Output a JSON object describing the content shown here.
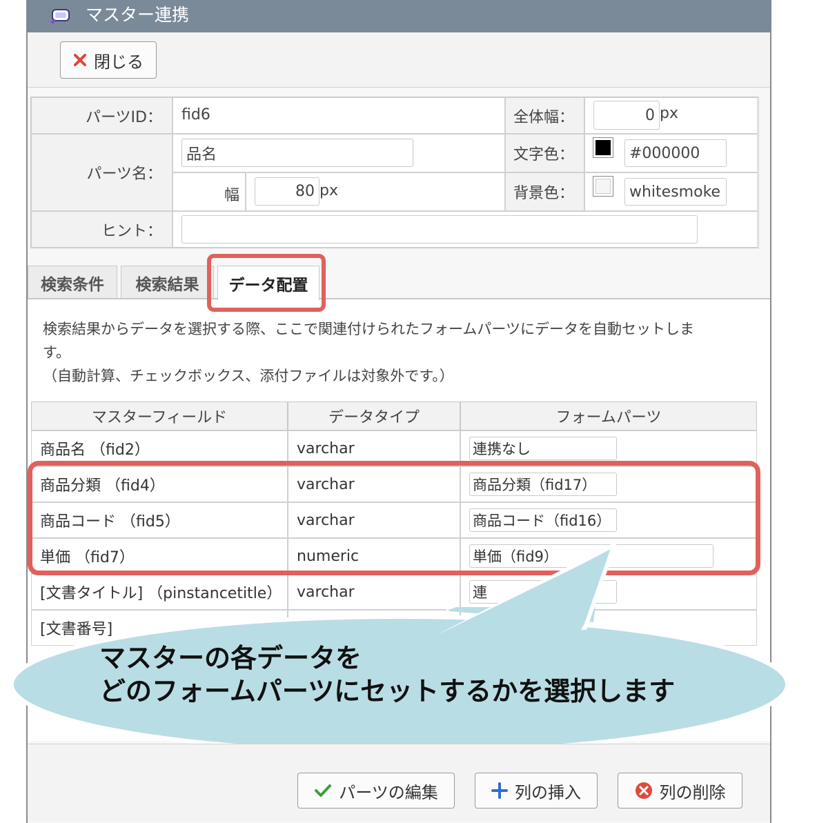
{
  "dialog": {
    "title": "マスター連携"
  },
  "toolbar": {
    "close_label": "閉じる"
  },
  "form": {
    "parts_id_label": "パーツID：",
    "parts_id_value": "fid6",
    "total_width_label": "全体幅：",
    "total_width_value": "0",
    "total_width_unit": "px",
    "parts_name_label": "パーツ名：",
    "parts_name_value": "品名",
    "text_color_label": "文字色：",
    "text_color_value": "#000000",
    "width_label": "幅",
    "width_value": "80",
    "width_unit": "px",
    "bg_color_label": "背景色：",
    "bg_color_value": "whitesmoke",
    "hint_label": "ヒント：",
    "hint_value": ""
  },
  "tabs": [
    {
      "label": "検索条件",
      "active": false
    },
    {
      "label": "検索結果",
      "active": false
    },
    {
      "label": "データ配置",
      "active": true
    }
  ],
  "description": {
    "line1": "検索結果からデータを選択する際、ここで関連付けられたフォームパーツにデータを自動セットしま",
    "line2": "す。",
    "line3": "（自動計算、チェックボックス、添付ファイルは対象外です。）"
  },
  "table": {
    "headers": [
      "マスターフィールド",
      "データタイプ",
      "フォームパーツ"
    ],
    "rows": [
      {
        "field": "商品名 （fid2）",
        "type": "varchar",
        "part": "連携なし"
      },
      {
        "field": "商品分類 （fid4）",
        "type": "varchar",
        "part": "商品分類（fid17）"
      },
      {
        "field": "商品コード （fid5）",
        "type": "varchar",
        "part": "商品コード（fid16）"
      },
      {
        "field": "単価 （fid7）",
        "type": "numeric",
        "part": "単価（fid9）"
      },
      {
        "field": "[文書タイトル] （pinstancetitle）",
        "type": "varchar",
        "part": "連"
      },
      {
        "field": "[文書番号]",
        "type": "",
        "part": ""
      }
    ]
  },
  "callout": {
    "line1": "マスターの各データを",
    "line2": "どのフォームパーツにセットするかを選択します"
  },
  "footer": {
    "edit_label": "パーツの編集",
    "insert_label": "列の挿入",
    "delete_label": "列の削除"
  },
  "colors": {
    "titlebar": "#7a8a99",
    "highlight": "#e0615c",
    "callout_fill": "#b9dde5",
    "check_green": "#3aa03a",
    "plus_blue": "#2a6fd6",
    "delete_red": "#e04a3a"
  }
}
